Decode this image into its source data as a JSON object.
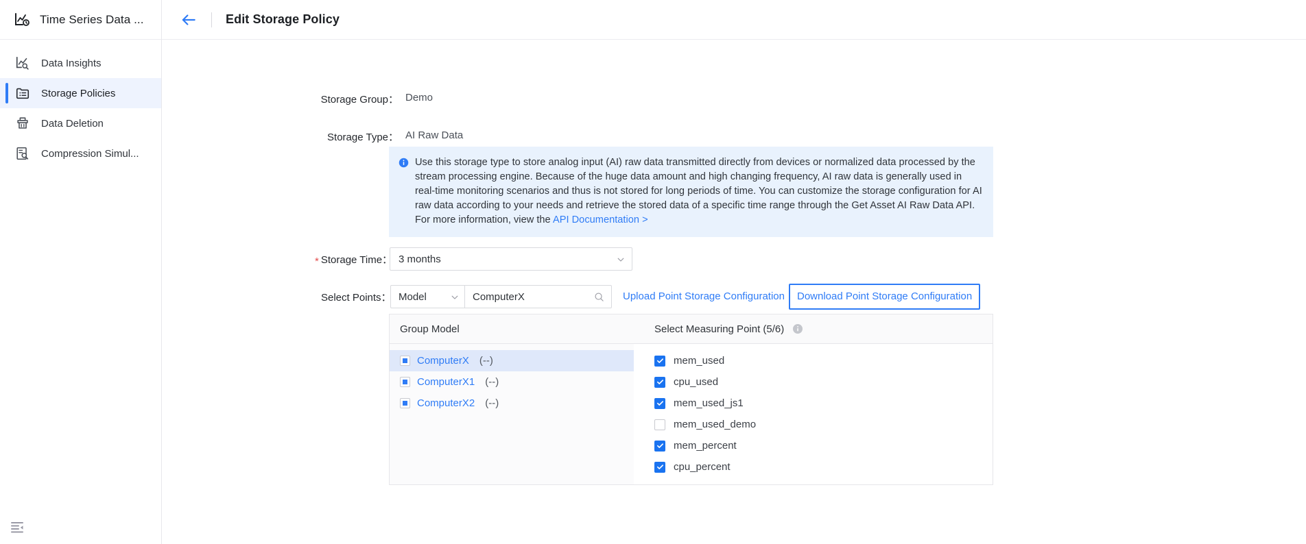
{
  "sidebar": {
    "brand": {
      "title": "Time Series Data ...",
      "icon": "time-series-chart-icon"
    },
    "items": [
      {
        "label": "Data Insights",
        "icon": "data-insights-icon",
        "active": false
      },
      {
        "label": "Storage Policies",
        "icon": "storage-policies-icon",
        "active": true
      },
      {
        "label": "Data Deletion",
        "icon": "data-deletion-icon",
        "active": false
      },
      {
        "label": "Compression Simul...",
        "icon": "compression-simulation-icon",
        "active": false
      }
    ],
    "collapse_icon": "sidebar-collapse-icon"
  },
  "topbar": {
    "back_icon": "back-arrow-icon",
    "title": "Edit Storage Policy"
  },
  "form": {
    "storage_group": {
      "label": "Storage Group：",
      "value": "Demo"
    },
    "storage_type": {
      "label": "Storage Type：",
      "value": "AI Raw Data"
    },
    "info": {
      "icon": "info-circle-icon",
      "text": "Use this storage type to store analog input (AI) raw data transmitted directly from devices or normalized data processed by the stream processing engine. Because of the huge data amount and high changing frequency, AI raw data is generally used in real-time monitoring scenarios and thus is not stored for long periods of time. You can customize the storage configuration for AI raw data according to your needs and retrieve the stored data of a specific time range through the Get Asset AI Raw Data API. For more information, view the ",
      "link_text": "API Documentation >"
    },
    "storage_time": {
      "required_mark": "*",
      "label": "Storage Time：",
      "value": "3 months",
      "chevron_icon": "chevron-down-icon"
    },
    "select_points": {
      "label": "Select Points：",
      "type_value": "Model",
      "type_chevron_icon": "chevron-down-icon",
      "search_value": "ComputerX",
      "search_placeholder": "Please enter",
      "search_icon": "search-icon",
      "upload_label": "Upload Point Storage Configuration",
      "download_label": "Download Point Storage Configuration"
    }
  },
  "table": {
    "headers": {
      "left": "Group Model",
      "right": "Select Measuring Point (5/6)",
      "right_help_icon": "question-circle-icon"
    },
    "group_models": [
      {
        "name": "ComputerX",
        "suffix": "(--)",
        "selected": true,
        "checkbox": "partial"
      },
      {
        "name": "ComputerX1",
        "suffix": "(--)",
        "selected": false,
        "checkbox": "partial"
      },
      {
        "name": "ComputerX2",
        "suffix": "(--)",
        "selected": false,
        "checkbox": "partial"
      }
    ],
    "measuring_points": [
      {
        "name": "mem_used",
        "checked": true
      },
      {
        "name": "cpu_used",
        "checked": true
      },
      {
        "name": "mem_used_js1",
        "checked": true
      },
      {
        "name": "mem_used_demo",
        "checked": false
      },
      {
        "name": "mem_percent",
        "checked": true
      },
      {
        "name": "cpu_percent",
        "checked": true
      }
    ]
  },
  "colors": {
    "accent": "#2f7cf6",
    "checkbox_on": "#1a73f0",
    "info_bg": "#e9f2fd",
    "active_nav_bg": "#eef3fe",
    "selected_row_bg": "#dfe8fa",
    "required_star": "#e34d4d"
  }
}
